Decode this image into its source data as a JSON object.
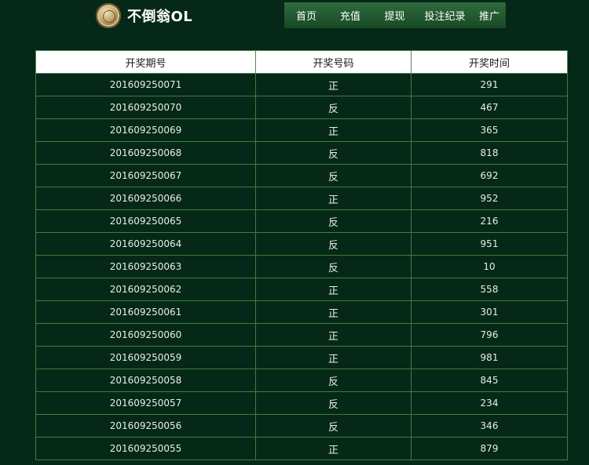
{
  "header": {
    "brand": "不倒翁OL",
    "nav": [
      "首页",
      "充值",
      "提现",
      "投注纪录",
      "推广"
    ]
  },
  "table": {
    "columns": [
      "开奖期号",
      "开奖号码",
      "开奖时间"
    ],
    "rows": [
      [
        "201609250071",
        "正",
        "291"
      ],
      [
        "201609250070",
        "反",
        "467"
      ],
      [
        "201609250069",
        "正",
        "365"
      ],
      [
        "201609250068",
        "反",
        "818"
      ],
      [
        "201609250067",
        "反",
        "692"
      ],
      [
        "201609250066",
        "正",
        "952"
      ],
      [
        "201609250065",
        "反",
        "216"
      ],
      [
        "201609250064",
        "反",
        "951"
      ],
      [
        "201609250063",
        "反",
        "10"
      ],
      [
        "201609250062",
        "正",
        "558"
      ],
      [
        "201609250061",
        "正",
        "301"
      ],
      [
        "201609250060",
        "正",
        "796"
      ],
      [
        "201609250059",
        "正",
        "981"
      ],
      [
        "201609250058",
        "反",
        "845"
      ],
      [
        "201609250057",
        "反",
        "234"
      ],
      [
        "201609250056",
        "反",
        "346"
      ],
      [
        "201609250055",
        "正",
        "879"
      ]
    ]
  }
}
